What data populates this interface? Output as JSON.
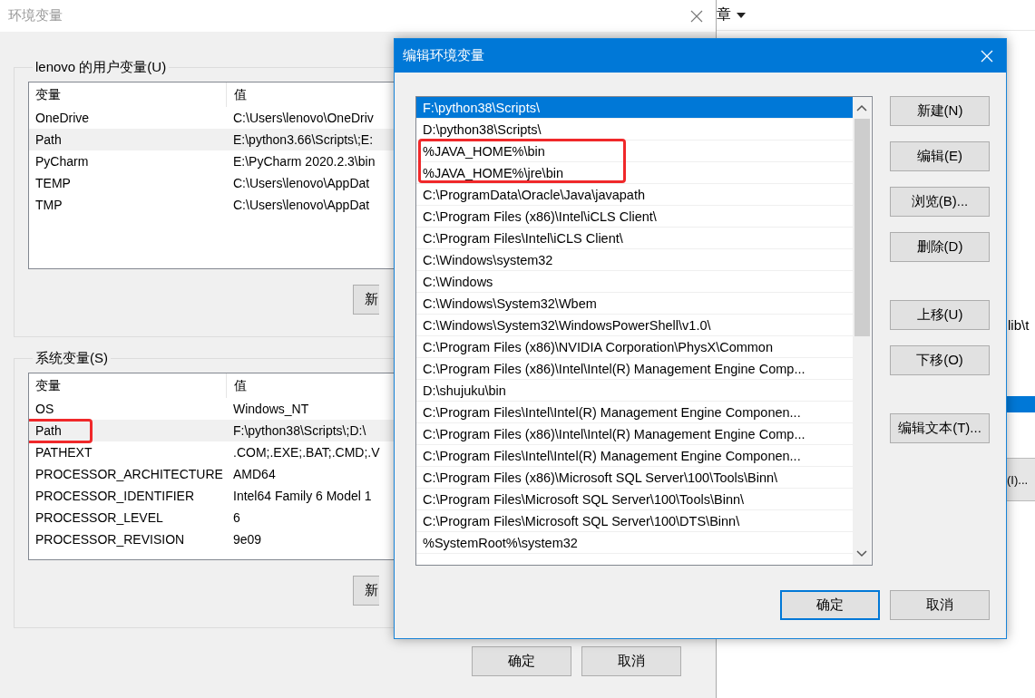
{
  "background_window": {
    "title_fragment": "章",
    "path_fragment": "lib\\t",
    "button_fragment": "(I)..."
  },
  "env_window": {
    "title": "环境变量",
    "groups": [
      {
        "label": "lenovo 的用户变量(U)",
        "columns": [
          "变量",
          "值"
        ],
        "button_fragment": "新",
        "rows": [
          {
            "name": "OneDrive",
            "value": "C:\\Users\\lenovo\\OneDriv",
            "selected": false,
            "annotated": false
          },
          {
            "name": "Path",
            "value": "E:\\python3.66\\Scripts\\;E:",
            "selected": true,
            "annotated": false
          },
          {
            "name": "PyCharm",
            "value": "E:\\PyCharm 2020.2.3\\bin",
            "selected": false,
            "annotated": false
          },
          {
            "name": "TEMP",
            "value": "C:\\Users\\lenovo\\AppDat",
            "selected": false,
            "annotated": false
          },
          {
            "name": "TMP",
            "value": "C:\\Users\\lenovo\\AppDat",
            "selected": false,
            "annotated": false
          }
        ]
      },
      {
        "label": "系统变量(S)",
        "columns": [
          "变量",
          "值"
        ],
        "button_fragment": "新",
        "rows": [
          {
            "name": "OS",
            "value": "Windows_NT",
            "selected": false,
            "annotated": false
          },
          {
            "name": "Path",
            "value": "F:\\python38\\Scripts\\;D:\\",
            "selected": true,
            "annotated": true
          },
          {
            "name": "PATHEXT",
            "value": ".COM;.EXE;.BAT;.CMD;.V",
            "selected": false,
            "annotated": false
          },
          {
            "name": "PROCESSOR_ARCHITECTURE",
            "value": "AMD64",
            "selected": false,
            "annotated": false
          },
          {
            "name": "PROCESSOR_IDENTIFIER",
            "value": "Intel64 Family 6 Model 1",
            "selected": false,
            "annotated": false
          },
          {
            "name": "PROCESSOR_LEVEL",
            "value": "6",
            "selected": false,
            "annotated": false
          },
          {
            "name": "PROCESSOR_REVISION",
            "value": "9e09",
            "selected": false,
            "annotated": false
          }
        ]
      }
    ],
    "buttons": [
      "确定",
      "取消"
    ]
  },
  "dialog": {
    "title": "编辑环境变量",
    "items": [
      {
        "text": "F:\\python38\\Scripts\\",
        "selected": true,
        "annotated": false
      },
      {
        "text": "D:\\python38\\Scripts\\",
        "selected": false,
        "annotated": false
      },
      {
        "text": "%JAVA_HOME%\\bin",
        "selected": false,
        "annotated": true
      },
      {
        "text": "%JAVA_HOME%\\jre\\bin",
        "selected": false,
        "annotated": true
      },
      {
        "text": "C:\\ProgramData\\Oracle\\Java\\javapath",
        "selected": false,
        "annotated": false
      },
      {
        "text": "C:\\Program Files (x86)\\Intel\\iCLS Client\\",
        "selected": false,
        "annotated": false
      },
      {
        "text": "C:\\Program Files\\Intel\\iCLS Client\\",
        "selected": false,
        "annotated": false
      },
      {
        "text": "C:\\Windows\\system32",
        "selected": false,
        "annotated": false
      },
      {
        "text": "C:\\Windows",
        "selected": false,
        "annotated": false
      },
      {
        "text": "C:\\Windows\\System32\\Wbem",
        "selected": false,
        "annotated": false
      },
      {
        "text": "C:\\Windows\\System32\\WindowsPowerShell\\v1.0\\",
        "selected": false,
        "annotated": false
      },
      {
        "text": "C:\\Program Files (x86)\\NVIDIA Corporation\\PhysX\\Common",
        "selected": false,
        "annotated": false
      },
      {
        "text": "C:\\Program Files (x86)\\Intel\\Intel(R) Management Engine Comp...",
        "selected": false,
        "annotated": false
      },
      {
        "text": "D:\\shujuku\\bin",
        "selected": false,
        "annotated": false
      },
      {
        "text": "C:\\Program Files\\Intel\\Intel(R) Management Engine Componen...",
        "selected": false,
        "annotated": false
      },
      {
        "text": "C:\\Program Files (x86)\\Intel\\Intel(R) Management Engine Comp...",
        "selected": false,
        "annotated": false
      },
      {
        "text": "C:\\Program Files\\Intel\\Intel(R) Management Engine Componen...",
        "selected": false,
        "annotated": false
      },
      {
        "text": "C:\\Program Files (x86)\\Microsoft SQL Server\\100\\Tools\\Binn\\",
        "selected": false,
        "annotated": false
      },
      {
        "text": "C:\\Program Files\\Microsoft SQL Server\\100\\Tools\\Binn\\",
        "selected": false,
        "annotated": false
      },
      {
        "text": "C:\\Program Files\\Microsoft SQL Server\\100\\DTS\\Binn\\",
        "selected": false,
        "annotated": false
      },
      {
        "text": "%SystemRoot%\\system32",
        "selected": false,
        "annotated": false
      }
    ],
    "button_groups": [
      [
        "新建(N)",
        "编辑(E)",
        "浏览(B)...",
        "删除(D)"
      ],
      [
        "上移(U)",
        "下移(O)"
      ],
      [
        "编辑文本(T)..."
      ]
    ],
    "footer_buttons": [
      {
        "label": "确定",
        "default": true
      },
      {
        "label": "取消",
        "default": false
      }
    ]
  }
}
